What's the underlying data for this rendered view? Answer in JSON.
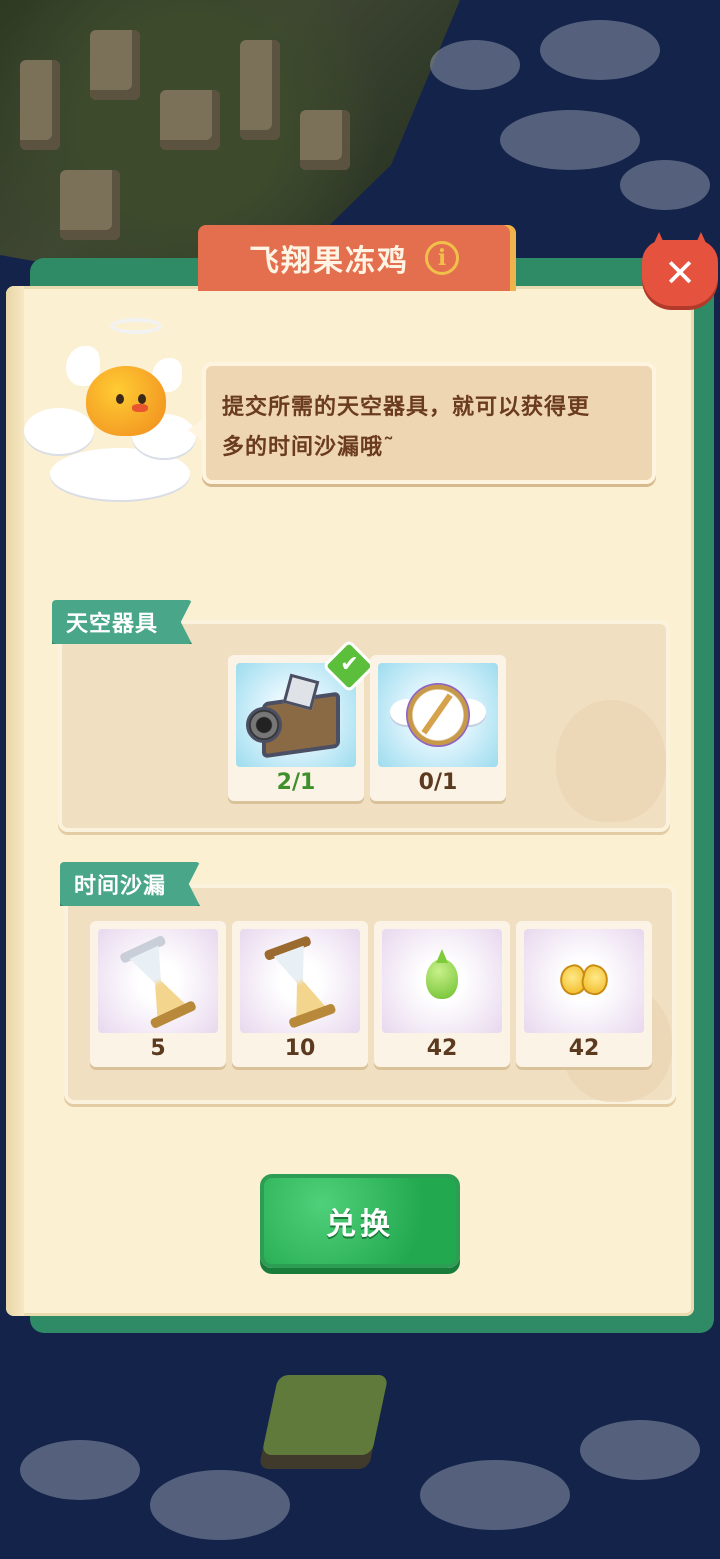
{
  "title": "飞翔果冻鸡",
  "info_icon_glyph": "i",
  "close_glyph": "✕",
  "speech": {
    "line1": "提交所需的天空器具，就可以获得更",
    "line2": "多的时间沙漏哦˜"
  },
  "sky_tools": {
    "label": "天空器具",
    "items": [
      {
        "icon": "camera-icon",
        "count": "2/1",
        "completed": true
      },
      {
        "icon": "compass-icon",
        "count": "0/1",
        "completed": false
      }
    ]
  },
  "hourglass_section": {
    "label": "时间沙漏",
    "items": [
      {
        "icon": "silver-hourglass-icon",
        "count": "5"
      },
      {
        "icon": "gold-hourglass-icon",
        "count": "10"
      },
      {
        "icon": "green-slime-icon",
        "count": "42"
      },
      {
        "icon": "golden-wings-icon",
        "count": "42"
      }
    ]
  },
  "check_glyph": "✔",
  "exchange_button": "兑换",
  "colors": {
    "banner": "#e36f4e",
    "panel_border": "#2f8a66",
    "section_tag": "#4aa688",
    "exchange_button": "#22a84e",
    "close_button": "#e5533e"
  }
}
